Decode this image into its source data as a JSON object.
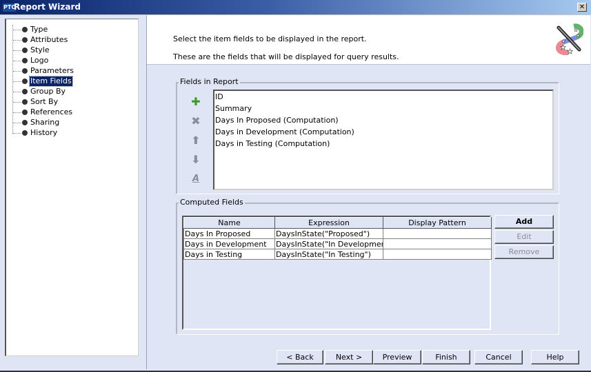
{
  "window": {
    "logo": "PTC",
    "title": "Report Wizard",
    "close_label": "✕"
  },
  "sidebar": {
    "items": [
      {
        "label": "Type",
        "selected": false
      },
      {
        "label": "Attributes",
        "selected": false
      },
      {
        "label": "Style",
        "selected": false
      },
      {
        "label": "Logo",
        "selected": false
      },
      {
        "label": "Parameters",
        "selected": false
      },
      {
        "label": "Item Fields",
        "selected": true
      },
      {
        "label": "Group By",
        "selected": false
      },
      {
        "label": "Sort By",
        "selected": false
      },
      {
        "label": "References",
        "selected": false
      },
      {
        "label": "Sharing",
        "selected": false
      },
      {
        "label": "History",
        "selected": false
      }
    ]
  },
  "header": {
    "line1": "Select the item fields to be displayed in the report.",
    "line2": "These are the fields that will be displayed for query results.",
    "icon": "magic-wand-icon"
  },
  "fields_in_report": {
    "title": "Fields in Report",
    "tools": [
      {
        "name": "add-field-icon",
        "glyph": "✚",
        "color": "#3a9a2a"
      },
      {
        "name": "remove-field-icon",
        "glyph": "✖",
        "color": "#8a8e96"
      },
      {
        "name": "move-up-icon",
        "glyph": "⬆",
        "color": "#8a8e96"
      },
      {
        "name": "move-down-icon",
        "glyph": "⬇",
        "color": "#8a8e96"
      },
      {
        "name": "rename-field-icon",
        "glyph": "A",
        "color": "#8a8e96"
      }
    ],
    "items": [
      "ID",
      "Summary",
      "Days In Proposed (Computation)",
      "Days in Development (Computation)",
      "Days in Testing (Computation)"
    ]
  },
  "computed_fields": {
    "title": "Computed Fields",
    "columns": [
      "Name",
      "Expression",
      "Display Pattern"
    ],
    "rows": [
      {
        "name": "Days In Proposed",
        "expression": "DaysInState(\"Proposed\")",
        "pattern": ""
      },
      {
        "name": "Days in Development",
        "expression": "DaysInState(\"In Development\")",
        "pattern": ""
      },
      {
        "name": "Days in Testing",
        "expression": "DaysInState(\"In Testing\")",
        "pattern": ""
      }
    ],
    "buttons": {
      "add": "Add",
      "edit": "Edit",
      "remove": "Remove"
    }
  },
  "footer": {
    "back": "< Back",
    "next": "Next >",
    "preview": "Preview",
    "finish": "Finish",
    "cancel": "Cancel",
    "help": "Help"
  }
}
